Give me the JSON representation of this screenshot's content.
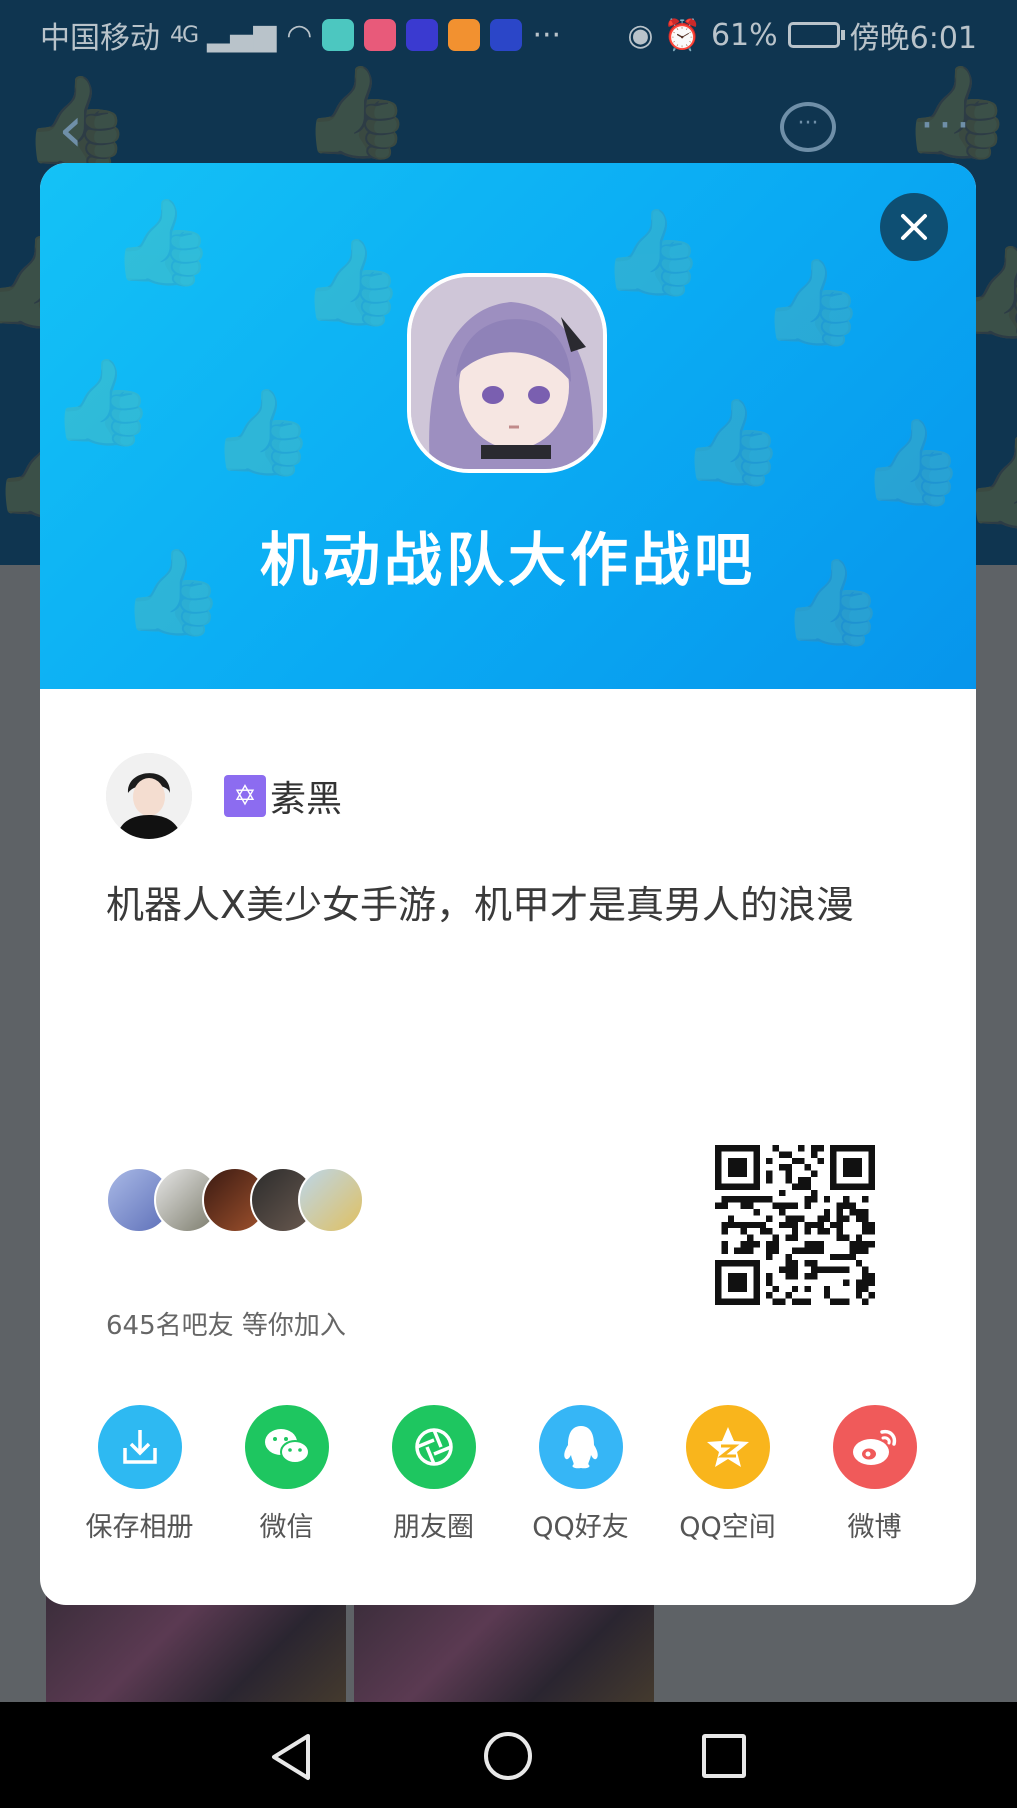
{
  "status_bar": {
    "carrier": "中国移动",
    "network": "4G",
    "battery": "61%",
    "time": "傍晚6:01"
  },
  "card": {
    "title": "机动战队大作战吧",
    "author_name": "素黑",
    "description": "机器人X美少女手游，机甲才是真男人的浪漫",
    "members_text": "645名吧友 等你加入",
    "banner_color": "#0aaaf3"
  },
  "share": {
    "items": [
      {
        "label": "保存相册",
        "icon": "download-icon",
        "color": "#2eb9f2"
      },
      {
        "label": "微信",
        "icon": "wechat-icon",
        "color": "#1ec660"
      },
      {
        "label": "朋友圈",
        "icon": "moments-icon",
        "color": "#1ec660"
      },
      {
        "label": "QQ好友",
        "icon": "qq-icon",
        "color": "#36b6f6"
      },
      {
        "label": "QQ空间",
        "icon": "qzone-icon",
        "color": "#f9b51c"
      },
      {
        "label": "微博",
        "icon": "weibo-icon",
        "color": "#f05a5a"
      }
    ]
  }
}
